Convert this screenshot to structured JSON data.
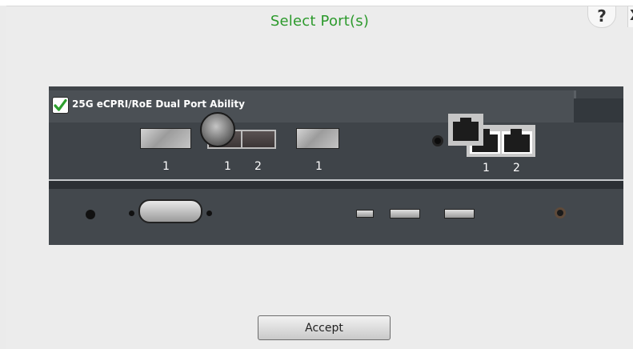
{
  "dialog": {
    "title": "Select Port(s)",
    "help_label": "?",
    "close_label": "X",
    "accept_label": "Accept"
  },
  "module": {
    "name": "25G eCPRI/RoE Dual Port Ability",
    "checked": true,
    "port_labels": {
      "sfp_a": "1",
      "dual_1": "1",
      "dual_2": "2",
      "sfp_b": "1",
      "rj45_1": "1",
      "rj45_2": "2"
    }
  },
  "colors": {
    "title": "#2c9a2c",
    "panel": "#3f4449",
    "check": "#2ea02e"
  },
  "icons": [
    "checkmark-icon",
    "help-icon",
    "close-icon"
  ]
}
